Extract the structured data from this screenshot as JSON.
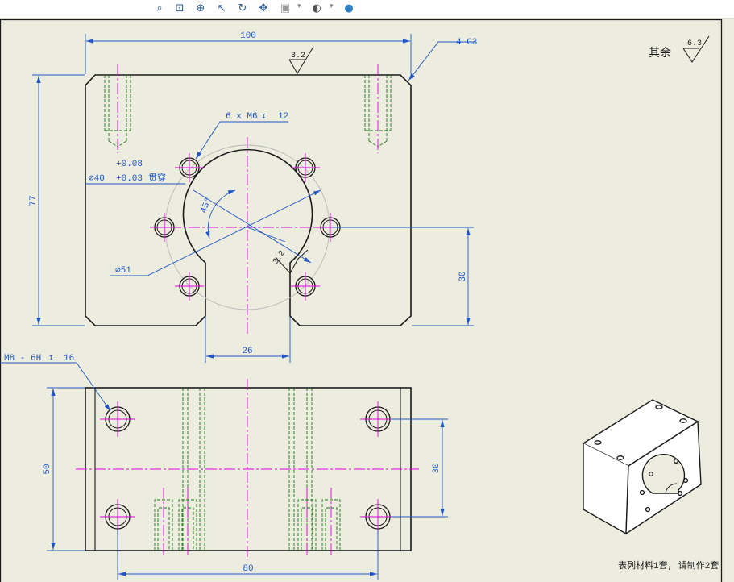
{
  "toolbar": {
    "icons": [
      "zoom-to-fit-icon",
      "zoom-to-area-icon",
      "zoom-in-out-icon",
      "select-icon",
      "rotate-icon",
      "pan-icon",
      "display-style-icon",
      "hide-show-icon",
      "appearance-icon"
    ]
  },
  "colors": {
    "background": "#ececdf",
    "outline": "#1b1b1b",
    "dimension": "#1f56c6",
    "centerline": "#e000e0",
    "hidden_line": "#1a7a1a"
  },
  "front_view": {
    "width_dim": "100",
    "height_dim": "77",
    "chamfer_note": "4-C3",
    "top_roughness": "3.2",
    "holes_note": "6 x  M6",
    "holes_depth": "12",
    "bore_tol_upper": "+0.08",
    "bore_diameter": "∅40",
    "bore_tol_lower": "+0.03",
    "bore_through": "贯穿",
    "angle_dim": "45°",
    "pitch_circle": "∅51",
    "bore_roughness": "3.2",
    "slot_width": "26",
    "center_height": "30"
  },
  "top_view": {
    "tapped_note": "M8 - 6H",
    "tapped_depth": "16",
    "depth_dim": "50",
    "hole_spacing_y": "30",
    "hole_spacing_x": "80"
  },
  "surface_finish": {
    "label": "其余",
    "value": "6.3"
  },
  "footer_note": "表列材料1套, 请制作2套"
}
